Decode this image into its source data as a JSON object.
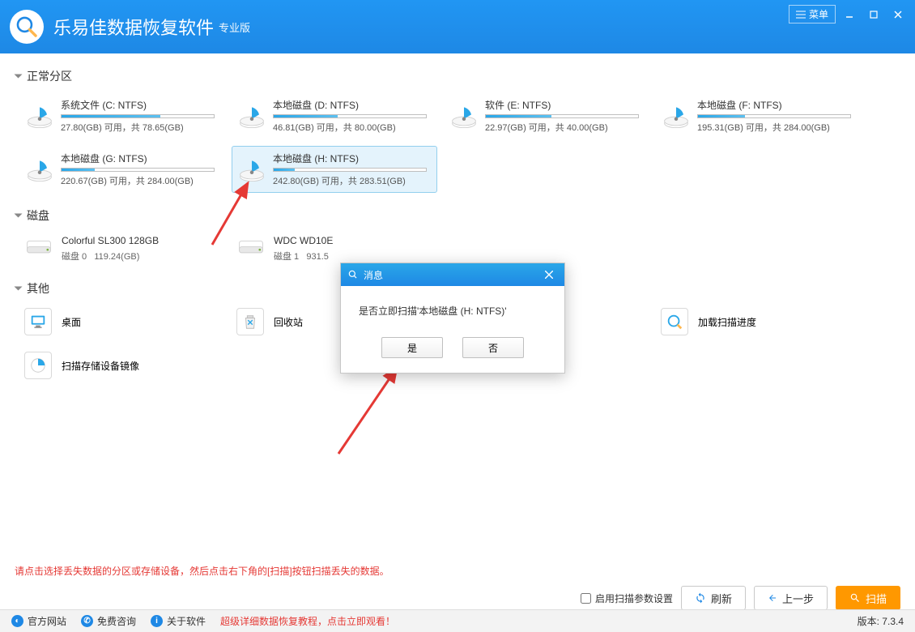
{
  "app": {
    "title": "乐易佳数据恢复软件",
    "edition": "专业版",
    "menu_label": "菜单"
  },
  "sections": {
    "partitions_title": "正常分区",
    "disks_title": "磁盘",
    "other_title": "其他"
  },
  "partitions": [
    {
      "name": "系统文件 (C: NTFS)",
      "free": "27.80(GB)",
      "total": "78.65(GB)",
      "used_pct": 65
    },
    {
      "name": "本地磁盘 (D: NTFS)",
      "free": "46.81(GB)",
      "total": "80.00(GB)",
      "used_pct": 42
    },
    {
      "name": "软件 (E: NTFS)",
      "free": "22.97(GB)",
      "total": "40.00(GB)",
      "used_pct": 43
    },
    {
      "name": "本地磁盘 (F: NTFS)",
      "free": "195.31(GB)",
      "total": "284.00(GB)",
      "used_pct": 31
    },
    {
      "name": "本地磁盘 (G: NTFS)",
      "free": "220.67(GB)",
      "total": "284.00(GB)",
      "used_pct": 22
    },
    {
      "name": "本地磁盘 (H: NTFS)",
      "free": "242.80(GB)",
      "total": "283.51(GB)",
      "used_pct": 14,
      "selected": true
    }
  ],
  "disks": [
    {
      "name": "Colorful SL300 128GB",
      "idx": "磁盘 0",
      "size": "119.24(GB)"
    },
    {
      "name": "WDC WD10E",
      "idx": "磁盘 1",
      "size": "931.5"
    }
  ],
  "other_items": [
    {
      "label": "桌面",
      "icon": "desktop"
    },
    {
      "label": "回收站",
      "icon": "recycle"
    },
    {
      "label": "",
      "icon": "hidden"
    },
    {
      "label": "加载扫描进度",
      "icon": "progress"
    },
    {
      "label": "扫描存储设备镜像",
      "icon": "image"
    }
  ],
  "labels": {
    "free_label": "可用，共",
    "enable_params": "启用扫描参数设置",
    "refresh": "刷新",
    "prev": "上一步",
    "scan": "扫描"
  },
  "tip": "请点击选择丢失数据的分区或存储设备，然后点击右下角的[扫描]按钮扫描丢失的数据。",
  "status": {
    "website": "官方网站",
    "consult": "免费咨询",
    "about": "关于软件",
    "tutorial": "超级详细数据恢复教程，点击立即观看！",
    "version": "版本: 7.3.4"
  },
  "modal": {
    "title": "消息",
    "body": "是否立即扫描'本地磁盘 (H: NTFS)'",
    "yes": "是",
    "no": "否"
  }
}
